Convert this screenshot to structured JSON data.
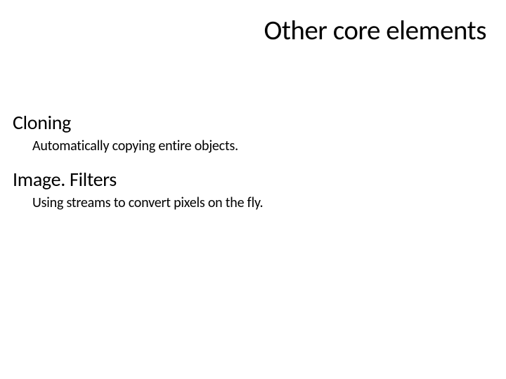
{
  "title": "Other core elements",
  "sections": [
    {
      "heading": "Cloning",
      "description": "Automatically copying entire objects."
    },
    {
      "heading": "Image. Filters",
      "description": "Using streams to convert pixels on the fly."
    }
  ]
}
